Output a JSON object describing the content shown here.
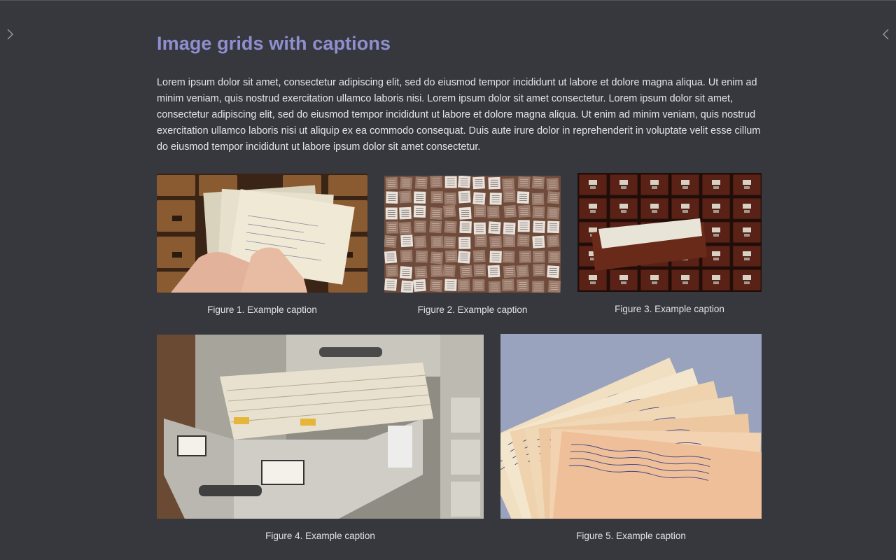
{
  "page": {
    "title": "Image grids with captions",
    "intro": "Lorem ipsum dolor sit amet, consectetur adipiscing elit, sed do eiusmod tempor incididunt ut labore et dolore magna aliqua. Ut enim ad minim veniam, quis nostrud exercitation ullamco laboris nisi. Lorem ipsum dolor sit amet consectetur. Lorem ipsum dolor sit amet, consectetur adipiscing elit, sed do eiusmod tempor incididunt ut labore et dolore magna aliqua. Ut enim ad minim veniam, quis nostrud exercitation ullamco laboris nisi ut aliquip ex ea commodo consequat. Duis aute irure dolor in reprehenderit in voluptate velit esse cillum do eiusmod tempor incididunt ut labore ipsum dolor sit amet consectetur."
  },
  "navigation": {
    "prev_icon": "chevron-right-icon",
    "next_icon": "chevron-left-icon"
  },
  "figures": [
    {
      "caption": "Figure 1. Example caption",
      "image": "hands-holding-index-cards"
    },
    {
      "caption": "Figure 2. Example caption",
      "image": "wall-of-paper-cards"
    },
    {
      "caption": "Figure 3. Example caption",
      "image": "wooden-card-catalog-drawer"
    },
    {
      "caption": "Figure 4. Example caption",
      "image": "metal-filing-cabinet-drawer"
    },
    {
      "caption": "Figure 5. Example caption",
      "image": "handwritten-index-cards"
    }
  ],
  "colors": {
    "background": "#37383e",
    "title": "#8e8fcf",
    "text": "#e4e4e8"
  }
}
